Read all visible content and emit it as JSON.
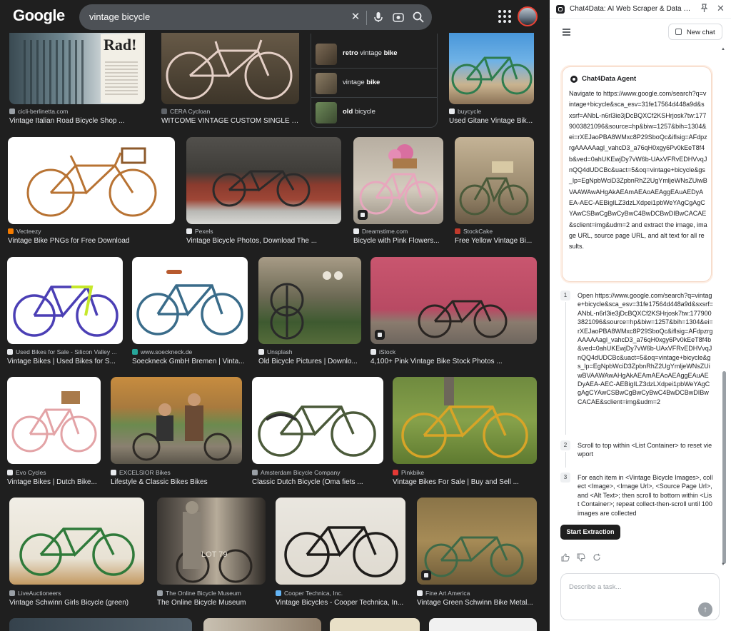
{
  "google": {
    "logo": "Google",
    "query": "vintage bicycle",
    "related": [
      {
        "bold_prefix": "retro",
        "rest": " vintage ",
        "bold_suffix": "bike"
      },
      {
        "bold_prefix": "",
        "rest": "vintage ",
        "bold_suffix": "bike"
      },
      {
        "bold_prefix": "old",
        "rest": " bicycle",
        "bold_suffix": ""
      }
    ],
    "results": [
      {
        "source": "cicli-berlinetta.com",
        "title": "Vintage Italian Road Bicycle Shop ...",
        "fav": "#9aa0a6"
      },
      {
        "source": "CERA Cycloan",
        "title": "WITCOME VINTAGE CUSTOM SINGLE S...",
        "fav": "#5f6368"
      },
      {
        "source": "buycycle",
        "title": "Used Gitane Vintage Bik...",
        "fav": "#e8eaed"
      },
      {
        "source": "Vecteezy",
        "title": "Vintage Bike PNGs for Free Download",
        "fav": "#f57c00"
      },
      {
        "source": "Pexels",
        "title": "Vintage Bicycle Photos, Download The ...",
        "fav": "#e8eaed"
      },
      {
        "source": "Dreamstime.com",
        "title": "Bicycle with Pink Flowers...",
        "fav": "#e8eaed"
      },
      {
        "source": "StockCake",
        "title": "Free Yellow Vintage Bi...",
        "fav": "#c0392b"
      },
      {
        "source": "Used Bikes for Sale - Silicon Valley ...",
        "title": "Vintage Bikes | Used Bikes for S...",
        "fav": "#e8eaed"
      },
      {
        "source": "www.soeckneck.de",
        "title": "Soeckneck GmbH Bremen | Vinta...",
        "fav": "#26a69a"
      },
      {
        "source": "Unsplash",
        "title": "Old Bicycle Pictures | Downlo...",
        "fav": "#e8eaed"
      },
      {
        "source": "iStock",
        "title": "4,100+ Pink Vintage Bike Stock Photos ...",
        "fav": "#e8eaed"
      },
      {
        "source": "Evo Cycles",
        "title": "Vintage Bikes | Dutch Bike...",
        "fav": "#e8eaed"
      },
      {
        "source": "EXCELSIOR Bikes",
        "title": "Lifestyle & Classic Bikes Bikes",
        "fav": "#e8eaed"
      },
      {
        "source": "Amsterdam Bicycle Company",
        "title": "Classic Dutch Bicycle (Oma fiets ...",
        "fav": "#9aa0a6"
      },
      {
        "source": "Pinkbike",
        "title": "Vintage Bikes For Sale | Buy and Sell ...",
        "fav": "#e53935"
      },
      {
        "source": "LiveAuctioneers",
        "title": "Vintage Schwinn Girls Bicycle (green)",
        "fav": "#9aa0a6"
      },
      {
        "source": "The Online Bicycle Museum",
        "title": "The Online Bicycle Museum",
        "fav": "#9aa0a6"
      },
      {
        "source": "Cooper Technica, Inc.",
        "title": "Vintage Bicycles - Cooper Technica, In...",
        "fav": "#64b5f6"
      },
      {
        "source": "Fine Art America",
        "title": "Vintage Green Schwinn Bike Metal...",
        "fav": "#e8eaed"
      }
    ],
    "hero_text": {
      "poster": "Rad!",
      "lot": "LOT 79"
    }
  },
  "extension": {
    "window_title": "Chat4Data: AI Web Scraper & Data Extr...",
    "new_chat_label": "New chat",
    "agent_name": "Chat4Data Agent",
    "agent_message": "Navigate to https://www.google.com/search?q=vintage+bicycle&sca_esv=31fe17564d448a9d&sxsrf=ANbL-n6rl3ie3jDcBQXCf2KSHrjosk7tw:1779003821096&source=hp&biw=1257&bih=1304&ei=rXEJaoPBA8WMxc8P29SboQc&iflsig=AFdpzrgAAAAAagl_vahcD3_a76qH0xgy6Pv0kEeT8f4b&ved=0ahUKEwjDy7vW6b-UAxVFRvEDHVvqJnQQ4dUDCBc&uact=5&oq=vintage+bicycle&gs_lp=EgNpbWciD3ZpbnRhZ2UgYmljeWNsZUiwBVAAWAwAHgAkAEAmAEAoAEAggEAuAEDyAEA-AEC-AEBigILZ3dzLXdpei1pbWeYAgCgAgCYAwCSBwCgBwCyBwC4BwDCBwDIBwCACAE&sclient=img&udm=2 and extract the image, image URL, source page URL, and alt text for all results.",
    "steps": [
      {
        "num": "1",
        "text": "Open https://www.google.com/search?q=vintage+bicycle&sca_esv=31fe17564d448a9d&sxsrf=ANbL-n6rl3ie3jDcBQXCf2KSHrjosk7tw:1779003821096&source=hp&biw=1257&bih=1304&ei=rXEJaoPBA8WMxc8P29SboQc&iflsig=AFdpzrgAAAAAagl_vahcD3_a76qH0xgy6Pv0kEeT8f4b&ved=0ahUKEwjDy7vW6b-UAxVFRvEDHVvqJnQQ4dUDCBc&uact=5&oq=vintage+bicycle&gs_lp=EgNpbWciD3ZpbnRhZ2UgYmljeWNsZUiwBVAAWAwAHgAkAEAmAEAoAEAggEAuAEDyAEA-AEC-AEBigILZ3dzLXdpei1pbWeYAgCgAgCYAwCSBwCgBwCyBwC4BwDCBwDIBwCACAE&sclient=img&udm=2"
      },
      {
        "num": "2",
        "text": "Scroll to top within <List Container> to reset viewport"
      },
      {
        "num": "3",
        "text": "For each item in <Vintage Bicycle Images>, collect <Image>, <Image Url>, <Source Page Url>, and <Alt Text>; then scroll to bottom within <List Container>; repeat collect-then-scroll until 100 images are collected"
      }
    ],
    "start_button": "Start Extraction",
    "input_placeholder": "Describe a task..."
  }
}
